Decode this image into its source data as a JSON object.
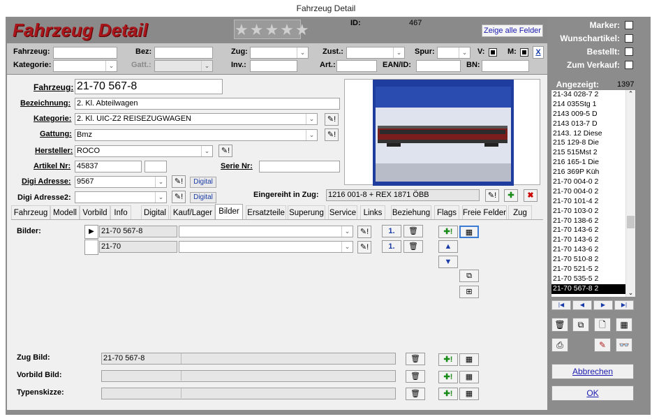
{
  "window": {
    "title": "Fahrzeug Detail"
  },
  "header": {
    "title": "Fahrzeug Detail",
    "stars": "★★★★★",
    "id_label": "ID:",
    "id_value": "467",
    "show_all_label": "Zeige alle Felder"
  },
  "filter": {
    "fahrzeug_label": "Fahrzeug:",
    "bez_label": "Bez:",
    "zug_label": "Zug:",
    "zust_label": "Zust.:",
    "spur_label": "Spur:",
    "v_label": "V:",
    "m_label": "M:",
    "x_label": "X",
    "kategorie_label": "Kategorie:",
    "gatt_label": "Gatt.:",
    "inv_label": "Inv.:",
    "art_label": "Art.:",
    "ean_label": "EAN/ID:",
    "bn_label": "BN:"
  },
  "right": {
    "marker_label": "Marker:",
    "wunschartikel_label": "Wunschartikel:",
    "bestellt_label": "Bestellt:",
    "verkauf_label": "Zum Verkauf:",
    "angezeigt_label": "Angezeigt:",
    "angezeigt_count": "1397",
    "list": [
      "21-34 028-7 2",
      "214 035Stg 1",
      "2143 009-5 D",
      "2143 013-7 D",
      "2143. 12 Diese",
      "215 129-8 Die",
      "215 515Mst 2",
      "216 165-1 Die",
      "216 369P Küh",
      "21-70 004-0 2",
      "21-70 004-0 2",
      "21-70 101-4 2",
      "21-70 103-0 2",
      "21-70 138-6 2",
      "21-70 143-6 2",
      "21-70 143-6 2",
      "21-70 143-6 2",
      "21-70 510-8 2",
      "21-70 521-5 2",
      "21-70 535-5 2",
      "21-70 567-8 2"
    ],
    "selected_index": 20,
    "cancel_label": "Abbrechen",
    "ok_label": "OK"
  },
  "form": {
    "fahrzeug_label": "Fahrzeug:",
    "fahrzeug_value": "21-70 567-8",
    "bezeichnung_label": "Bezeichnung:",
    "bezeichnung_value": "2. Kl. Abteilwagen",
    "kategorie_label": "Kategorie:",
    "kategorie_value": "2. Kl. UIC-Z2 REISEZUGWAGEN",
    "gattung_label": "Gattung:",
    "gattung_value": "Bmz",
    "hersteller_label": "Hersteller:",
    "hersteller_value": "ROCO",
    "artikel_label": "Artikel Nr:",
    "artikel_value": "45837",
    "serie_label": "Serie Nr:",
    "serie_value": "",
    "digi1_label": "Digi Adresse:",
    "digi1_value": "9567",
    "digi2_label": "Digi Adresse2:",
    "digi2_value": "",
    "digital_label": "Digital",
    "eingereiht_label": "Eingereiht in Zug:",
    "eingereiht_value": "1216 001-8 + REX 1871 ÖBB"
  },
  "tabs": [
    "Fahrzeug",
    "Modell",
    "Vorbild",
    "Info",
    "Digital",
    "Kauf/Lager",
    "Bilder",
    "Ersatzteile",
    "Superung",
    "Service",
    "Links",
    "Beziehung",
    "Flags",
    "Freie Felder",
    "Zug"
  ],
  "active_tab": "Bilder",
  "bilder": {
    "label": "Bilder:",
    "rows": [
      {
        "name": "21-70 567-8",
        "desc": "",
        "order": "1."
      },
      {
        "name": "21-70",
        "desc": "",
        "order": "1."
      }
    ],
    "zug_bild_label": "Zug Bild:",
    "zug_bild_value": "21-70 567-8",
    "vorbild_bild_label": "Vorbild Bild:",
    "vorbild_bild_value": "",
    "typenskizze_label": "Typenskizze:",
    "typenskizze_value": ""
  }
}
